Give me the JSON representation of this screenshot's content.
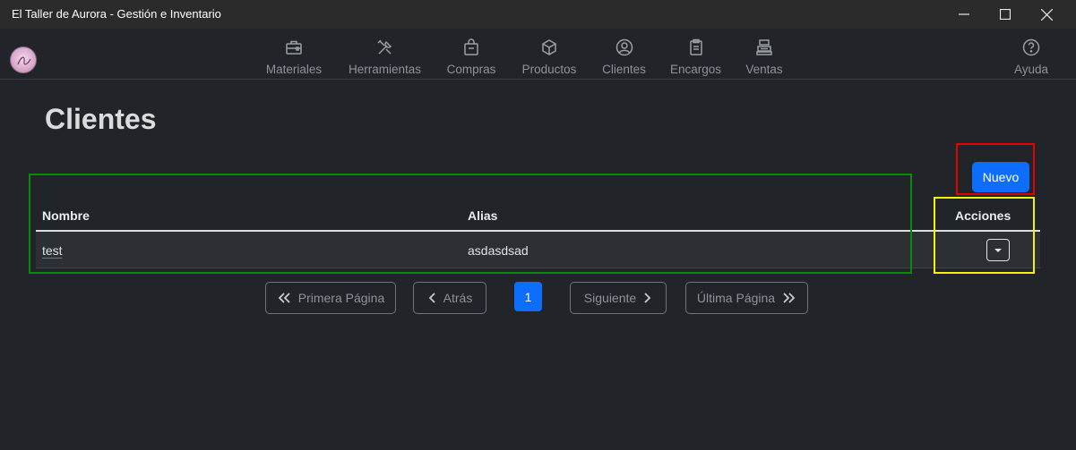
{
  "window": {
    "title": "El Taller de Aurora - Gestión e Inventario"
  },
  "nav": {
    "items": [
      {
        "label": "Materiales",
        "icon": "briefcase-icon"
      },
      {
        "label": "Herramientas",
        "icon": "tools-icon"
      },
      {
        "label": "Compras",
        "icon": "shopping-bag-icon"
      },
      {
        "label": "Productos",
        "icon": "box-icon"
      },
      {
        "label": "Clientes",
        "icon": "user-circle-icon"
      },
      {
        "label": "Encargos",
        "icon": "clipboard-icon"
      },
      {
        "label": "Ventas",
        "icon": "cash-register-icon"
      }
    ],
    "help": {
      "label": "Ayuda",
      "icon": "question-circle-icon"
    }
  },
  "page": {
    "title": "Clientes",
    "new_button": "Nuevo"
  },
  "table": {
    "headers": {
      "name": "Nombre",
      "alias": "Alias",
      "actions": "Acciones"
    },
    "rows": [
      {
        "name": "test",
        "alias": "asdasdsad"
      }
    ]
  },
  "pagination": {
    "first": "Primera Página",
    "prev": "Atrás",
    "current": "1",
    "next": "Siguiente",
    "last": "Última Página"
  },
  "colors": {
    "background": "#212529",
    "primary": "#0d6efd",
    "annotation_red": "#e60000",
    "annotation_green": "#0a8a0a",
    "annotation_yellow": "#f3f30a"
  }
}
